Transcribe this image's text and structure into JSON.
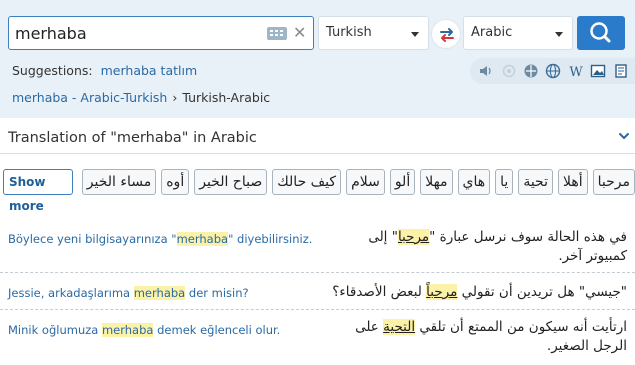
{
  "search": {
    "query": "merhaba"
  },
  "languages": {
    "source": "Turkish",
    "target": "Arabic"
  },
  "suggestions": {
    "label": "Suggestions:",
    "items": [
      "merhaba tatlım"
    ]
  },
  "breadcrumb": {
    "items": [
      "merhaba - Arabic-Turkish",
      "Turkish-Arabic"
    ]
  },
  "translation": {
    "title": "Translation of \"merhaba\" in Arabic",
    "chips": [
      "مساء الخير",
      "أوه",
      "صباح الخير",
      "كيف حالك",
      "سلام",
      "ألو",
      "مهلا",
      "هاي",
      "يا",
      "تحية",
      "أهلا",
      "مرحبا"
    ],
    "show_more": "Show more"
  },
  "examples": [
    {
      "src_before": "Böylece yeni bilgisayarınıza \"",
      "src_hl": "merhaba",
      "src_after": "\" diyebilirsiniz.",
      "tgt_before": "في هذه الحالة سوف نرسل عبارة \"",
      "tgt_hl": "مرحبا",
      "tgt_after": "\" إلى كمبيوتر آخر."
    },
    {
      "src_before": "Jessie, arkadaşlarıma ",
      "src_hl": "merhaba",
      "src_after": " der misin?",
      "tgt_before": "\"جيسي\" هل تريدين أن تقولي ",
      "tgt_hl": "مرحباً",
      "tgt_after": " لبعض الأصدقاء؟"
    },
    {
      "src_before": "Minik oğlumuza ",
      "src_hl": "merhaba",
      "src_after": " demek eğlenceli olur.",
      "tgt_before": "ارتأيت أنه سيكون من الممتع أن تلقي ",
      "tgt_hl": "التحية",
      "tgt_after": " على الرجل الصغير."
    }
  ],
  "tool_icons": [
    "speaker-icon",
    "circle-icon",
    "grid-icon",
    "globe-icon",
    "wikipedia-icon",
    "image-icon",
    "book-icon"
  ],
  "colors": {
    "accent": "#2a7bc9",
    "link": "#2a6aa4",
    "highlight": "#fbf2a8",
    "header_bg": "#e9f1f8"
  }
}
